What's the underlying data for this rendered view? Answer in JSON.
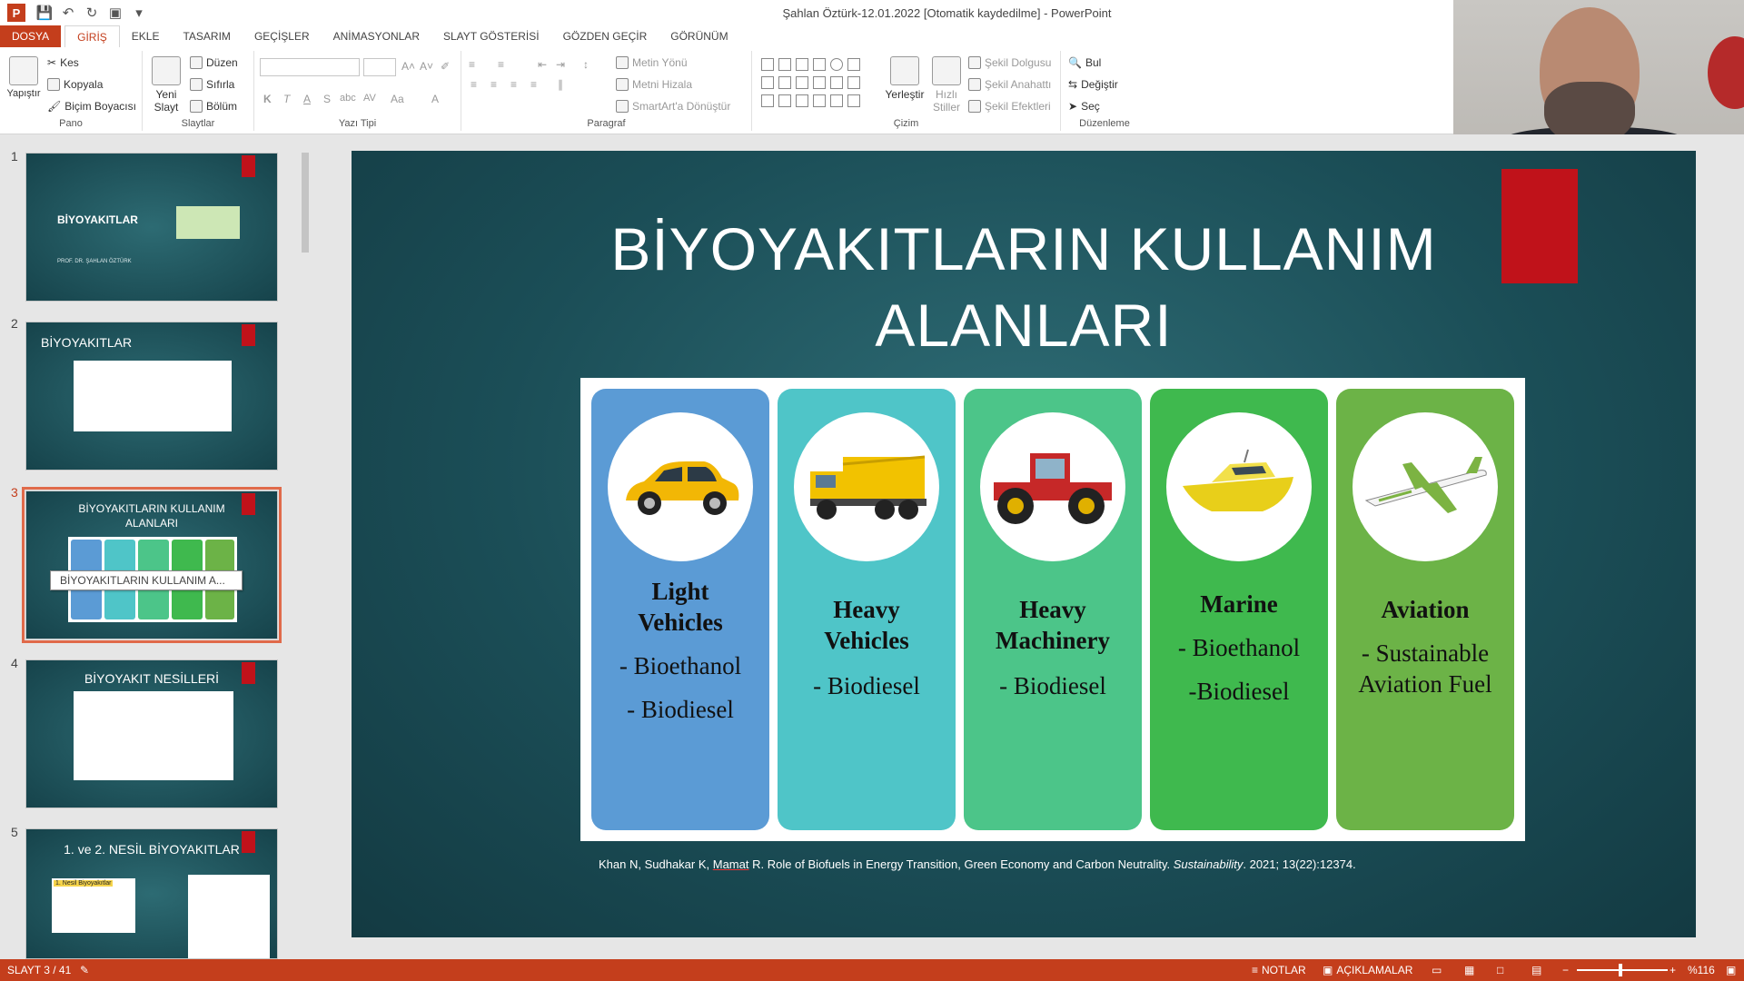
{
  "window": {
    "title": "Şahlan Öztürk-12.01.2022 [Otomatik kaydedilme] - PowerPoint"
  },
  "quick_access": {
    "icons": [
      "save-icon",
      "undo-icon",
      "redo-icon",
      "slideshow-icon",
      "customize-icon"
    ]
  },
  "tabs": [
    {
      "label": "DOSYA"
    },
    {
      "label": "GİRİŞ"
    },
    {
      "label": "EKLE"
    },
    {
      "label": "TASARIM"
    },
    {
      "label": "GEÇİŞLER"
    },
    {
      "label": "ANİMASYONLAR"
    },
    {
      "label": "SLAYT GÖSTERİSİ"
    },
    {
      "label": "GÖZDEN GEÇİR"
    },
    {
      "label": "GÖRÜNÜM"
    }
  ],
  "ribbon": {
    "pano": {
      "label": "Pano",
      "paste": "Yapıştır",
      "cut": "Kes",
      "copy": "Kopyala",
      "format_painter": "Biçim Boyacısı"
    },
    "slaytlar": {
      "label": "Slaytlar",
      "new_slide_line1": "Yeni",
      "new_slide_line2": "Slayt",
      "layout": "Düzen",
      "reset": "Sıfırla",
      "section": "Bölüm"
    },
    "yazi_tipi": {
      "label": "Yazı Tipi",
      "buttons": [
        "K",
        "T",
        "A",
        "S",
        "abc",
        "AV",
        "Aa",
        "A"
      ]
    },
    "paragraf": {
      "label": "Paragraf",
      "text_direction": "Metin Yönü",
      "align_text": "Metni Hizala",
      "smartart": "SmartArt'a Dönüştür"
    },
    "cizim": {
      "label": "Çizim",
      "arrange": "Yerleştir",
      "quick_styles_line1": "Hızlı",
      "quick_styles_line2": "Stiller",
      "shape_fill": "Şekil Dolgusu",
      "shape_outline": "Şekil Anahattı",
      "shape_effects": "Şekil Efektleri"
    },
    "duzenleme": {
      "label": "Düzenleme",
      "find": "Bul",
      "replace": "Değiştir",
      "select": "Seç"
    }
  },
  "thumbnails": [
    {
      "number": "1",
      "title": "BİYOYAKITLAR",
      "subtitle": "PROF. DR. ŞAHLAN ÖZTÜRK"
    },
    {
      "number": "2",
      "title": "BİYOYAKITLAR"
    },
    {
      "number": "3",
      "title_line1": "BİYOYAKITLARIN KULLANIM",
      "title_line2": "ALANLARI",
      "tooltip": "BİYOYAKITLARIN KULLANIM A..."
    },
    {
      "number": "4",
      "title": "BİYOYAKIT NESİLLERİ"
    },
    {
      "number": "5",
      "title": "1. ve 2. NESİL BİYOYAKITLAR",
      "inner_label": "1. Nesil Biyoyakıtlar"
    }
  ],
  "slide": {
    "title_line1": "BİYOYAKITLARIN KULLANIM",
    "title_line2": "ALANLARI",
    "cards": [
      {
        "title_lines": [
          "Light",
          "Vehicles"
        ],
        "items": [
          "- Bioethanol",
          "- Biodiesel"
        ],
        "color": "#5b9bd5",
        "icon": "car-icon"
      },
      {
        "title_lines": [
          "Heavy",
          "Vehicles"
        ],
        "items": [
          "- Biodiesel"
        ],
        "color": "#4fc5c8",
        "icon": "dump-truck-icon"
      },
      {
        "title_lines": [
          "Heavy",
          "Machinery"
        ],
        "items": [
          "- Biodiesel"
        ],
        "color": "#4cc589",
        "icon": "tractor-icon"
      },
      {
        "title_lines": [
          "Marine"
        ],
        "items": [
          "- Bioethanol",
          "-Biodiesel"
        ],
        "color": "#3fb94e",
        "icon": "yacht-icon"
      },
      {
        "title_lines": [
          "Aviation"
        ],
        "items": [
          "- Sustainable",
          "Aviation Fuel"
        ],
        "color": "#6cb347",
        "icon": "airplane-icon"
      }
    ],
    "citation": {
      "authors_a": "Khan N, Sudhakar K, ",
      "authors_b": "Mamat",
      "authors_c": " R. Role of Biofuels in Energy Transition, Green Economy and Carbon Neutrality. ",
      "journal": "Sustainability",
      "rest": ". 2021; 13(22):12374."
    }
  },
  "statusbar": {
    "slide_counter": "SLAYT 3 / 41",
    "notes": "NOTLAR",
    "comments": "AÇIKLAMALAR",
    "zoom": "%116"
  }
}
